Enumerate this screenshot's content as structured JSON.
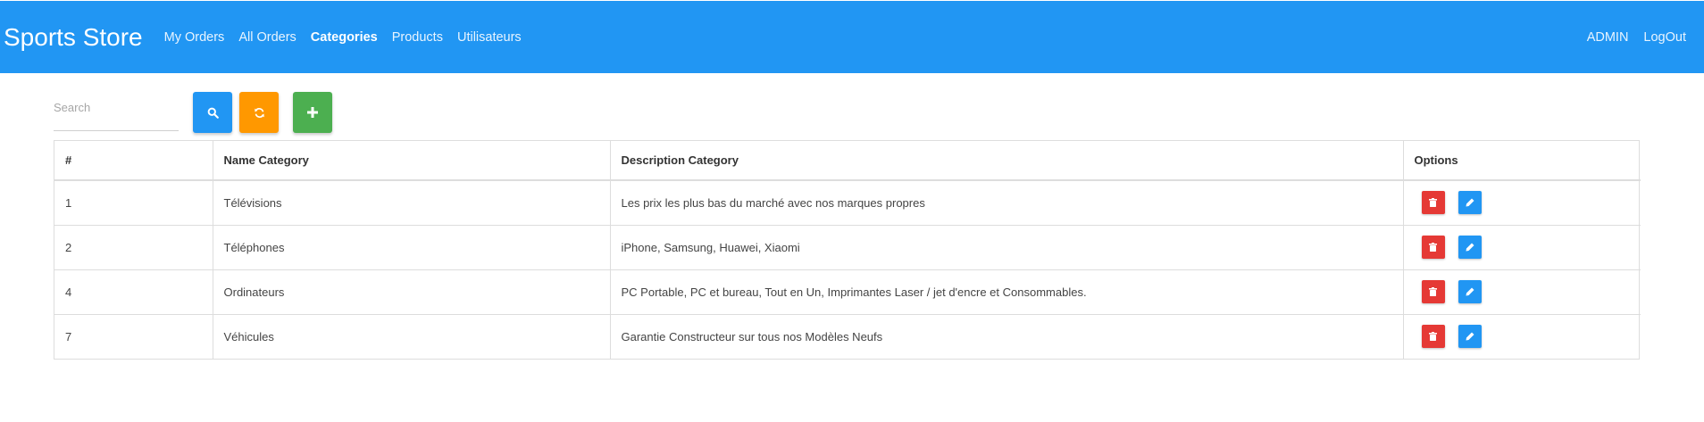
{
  "navbar": {
    "brand": "Sports Store",
    "links": [
      {
        "label": "My Orders",
        "active": false
      },
      {
        "label": "All Orders",
        "active": false
      },
      {
        "label": "Categories",
        "active": true
      },
      {
        "label": "Products",
        "active": false
      },
      {
        "label": "Utilisateurs",
        "active": false
      }
    ],
    "right": [
      {
        "label": "ADMIN"
      },
      {
        "label": "LogOut"
      }
    ]
  },
  "toolbar": {
    "search_placeholder": "Search",
    "search_value": "",
    "search_button_icon": "search-icon",
    "refresh_button_icon": "refresh-icon",
    "add_button_icon": "plus-icon"
  },
  "table": {
    "headers": [
      "#",
      "Name Category",
      "Description Category",
      "Options"
    ],
    "rows": [
      {
        "id": "1",
        "name": "Télévisions",
        "description": "Les prix les plus bas du marché avec nos marques propres"
      },
      {
        "id": "2",
        "name": "Téléphones",
        "description": "iPhone, Samsung, Huawei, Xiaomi"
      },
      {
        "id": "4",
        "name": "Ordinateurs",
        "description": "PC Portable, PC et bureau, Tout en Un, Imprimantes Laser / jet d'encre et Consommables."
      },
      {
        "id": "7",
        "name": "Véhicules",
        "description": "Garantie Constructeur sur tous nos Modèles Neufs"
      }
    ],
    "row_actions": [
      "trash-icon",
      "pencil-icon"
    ]
  },
  "colors": {
    "navbar": "#2196f3",
    "search_button": "#2196f3",
    "refresh_button": "#ff9800",
    "add_button": "#4caf50",
    "delete_button": "#e53935",
    "edit_button": "#2196f3"
  }
}
